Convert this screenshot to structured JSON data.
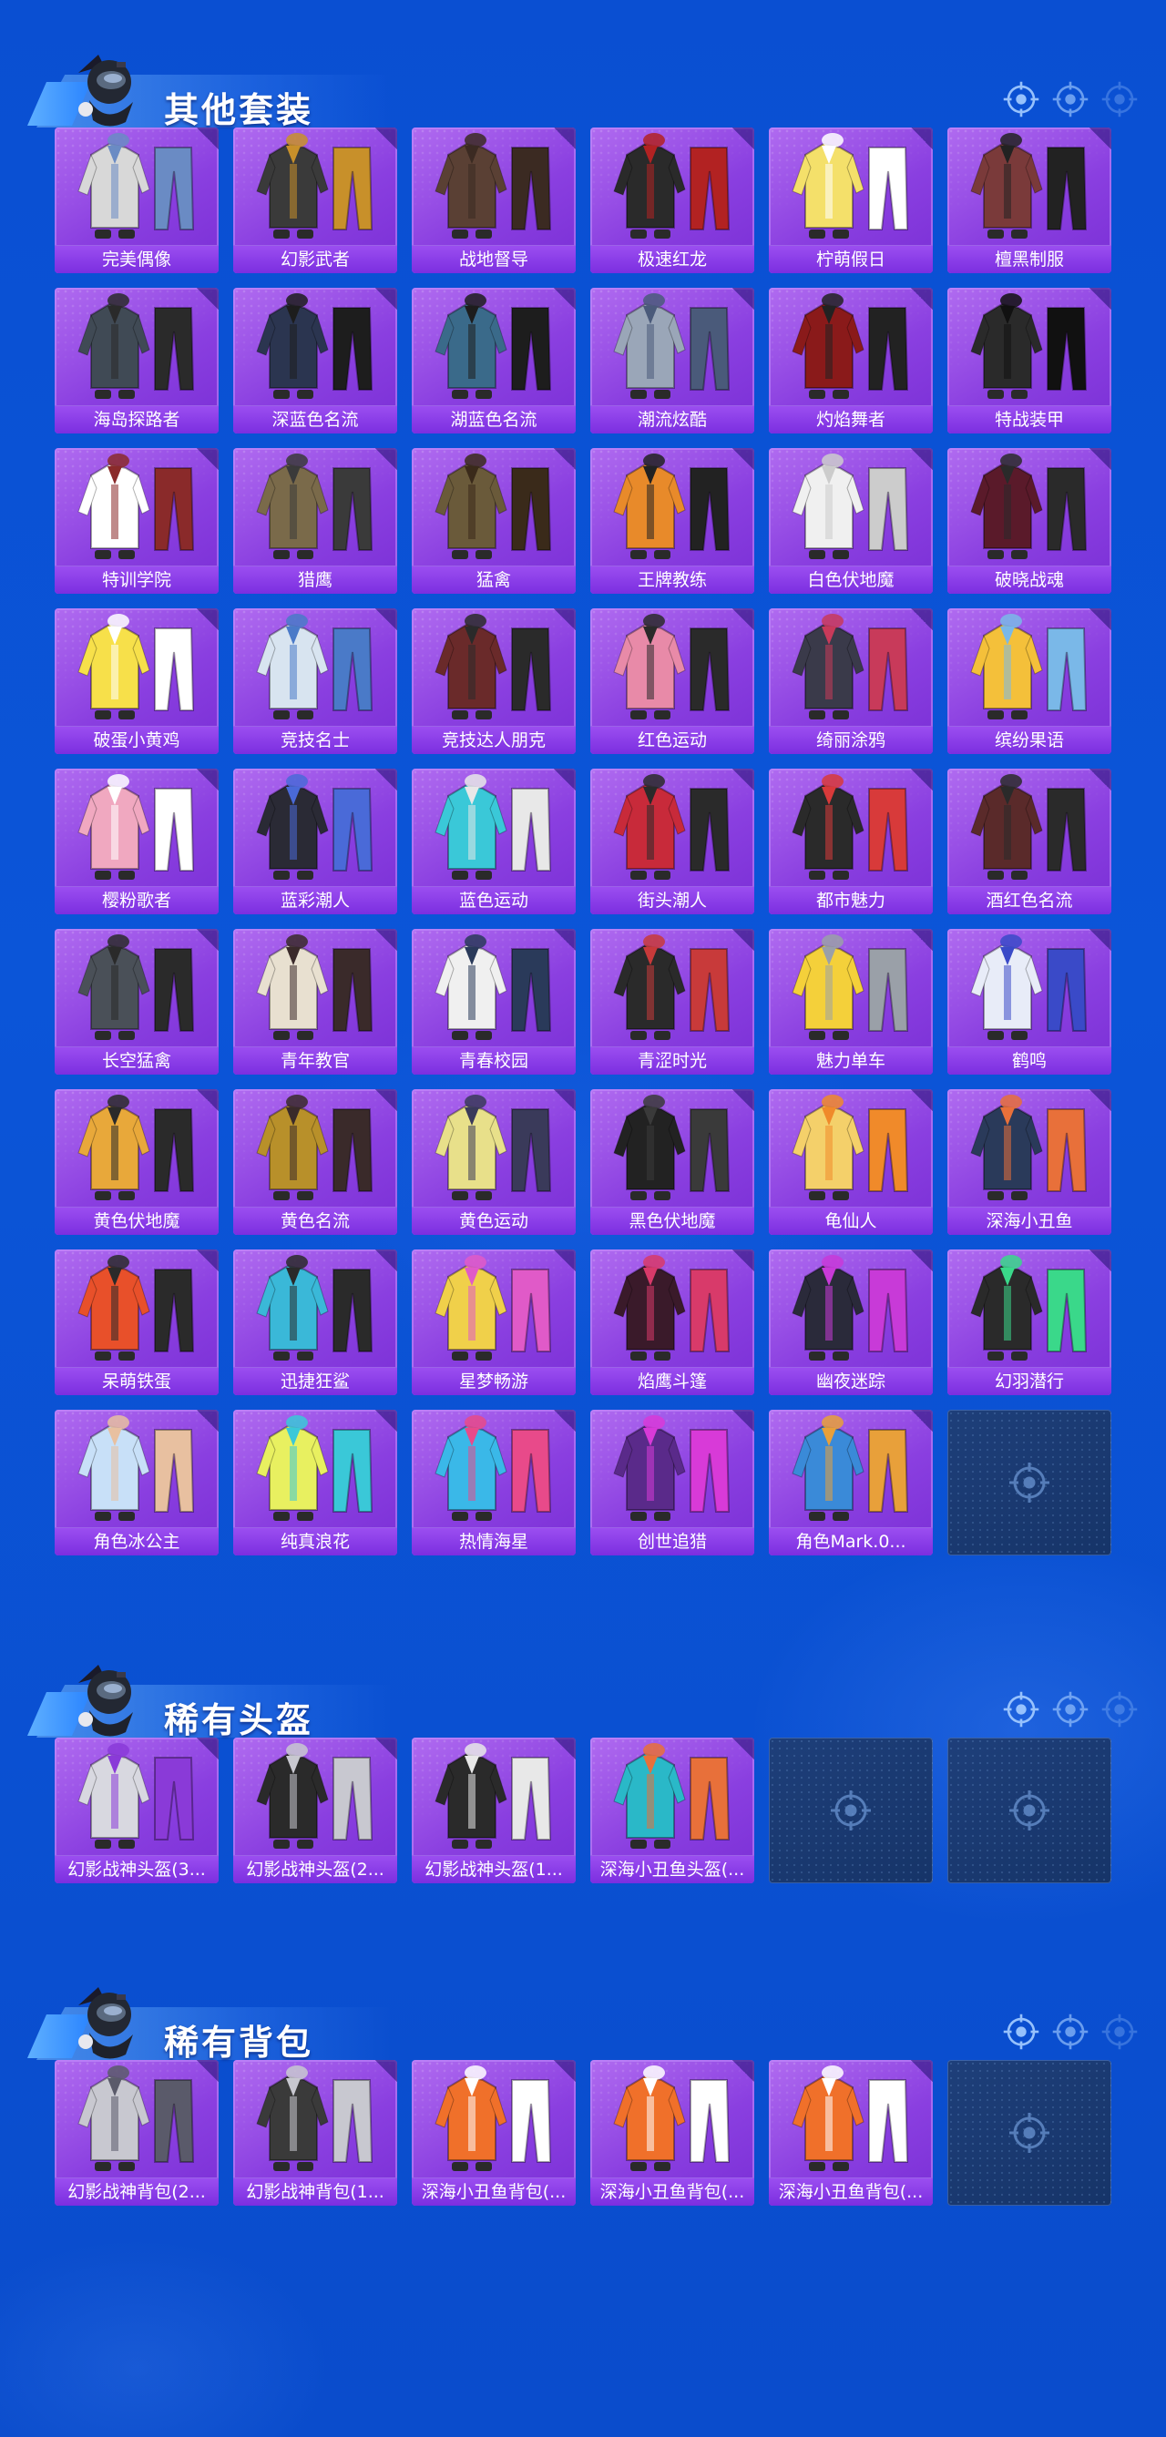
{
  "sections": [
    {
      "title": "其他套装",
      "items": [
        {
          "label": "完美偶像",
          "hue": "#d8d8d8",
          "acc": "#6a8bc4"
        },
        {
          "label": "幻影武者",
          "hue": "#3a3a3a",
          "acc": "#c8902a"
        },
        {
          "label": "战地督导",
          "hue": "#5a4034",
          "acc": "#3b2a22"
        },
        {
          "label": "极速红龙",
          "hue": "#2a2a2a",
          "acc": "#b22222"
        },
        {
          "label": "柠萌假日",
          "hue": "#f4e06a",
          "acc": "#ffffff"
        },
        {
          "label": "檀黑制服",
          "hue": "#7a3a3a",
          "acc": "#222222"
        },
        {
          "label": "海岛探路者",
          "hue": "#404a55",
          "acc": "#2a2a2a"
        },
        {
          "label": "深蓝色名流",
          "hue": "#2b3550",
          "acc": "#1d1d1d"
        },
        {
          "label": "湖蓝色名流",
          "hue": "#3a6a8a",
          "acc": "#1d1d1d"
        },
        {
          "label": "潮流炫酷",
          "hue": "#9aa6b8",
          "acc": "#4a5a7a"
        },
        {
          "label": "灼焰舞者",
          "hue": "#8a1a1a",
          "acc": "#222222"
        },
        {
          "label": "特战装甲",
          "hue": "#2a2a2a",
          "acc": "#111111"
        },
        {
          "label": "特训学院",
          "hue": "#ffffff",
          "acc": "#8a2a2a"
        },
        {
          "label": "猎鹰",
          "hue": "#7a6a4a",
          "acc": "#3a3a3a"
        },
        {
          "label": "猛禽",
          "hue": "#6a5a3a",
          "acc": "#3a2a1a"
        },
        {
          "label": "王牌教练",
          "hue": "#e88a2a",
          "acc": "#222222"
        },
        {
          "label": "白色伏地魔",
          "hue": "#f0f0f0",
          "acc": "#cccccc"
        },
        {
          "label": "破晓战魂",
          "hue": "#5a1a2a",
          "acc": "#2a2a2a"
        },
        {
          "label": "破蛋小黄鸡",
          "hue": "#f7e04a",
          "acc": "#ffffff"
        },
        {
          "label": "竞技名士",
          "hue": "#d8e4f0",
          "acc": "#4a7ac8"
        },
        {
          "label": "竞技达人朋克",
          "hue": "#6a2a2a",
          "acc": "#2a2a2a"
        },
        {
          "label": "红色运动",
          "hue": "#e88aa8",
          "acc": "#2a2a2a"
        },
        {
          "label": "绮丽涂鸦",
          "hue": "#3a3a4a",
          "acc": "#c83a5a"
        },
        {
          "label": "缤纷果语",
          "hue": "#f4c03a",
          "acc": "#7ab8e8"
        },
        {
          "label": "樱粉歌者",
          "hue": "#f0a8c0",
          "acc": "#ffffff"
        },
        {
          "label": "蓝彩潮人",
          "hue": "#2a2a35",
          "acc": "#4a6ad8"
        },
        {
          "label": "蓝色运动",
          "hue": "#3ac8d8",
          "acc": "#e8e8e8"
        },
        {
          "label": "街头潮人",
          "hue": "#c82a3a",
          "acc": "#2a2a2a"
        },
        {
          "label": "都市魅力",
          "hue": "#2a2a2a",
          "acc": "#d83a3a"
        },
        {
          "label": "酒红色名流",
          "hue": "#5a2a2a",
          "acc": "#2a2a2a"
        },
        {
          "label": "长空猛禽",
          "hue": "#4a5058",
          "acc": "#2a2a2a"
        },
        {
          "label": "青年教官",
          "hue": "#e8e0d0",
          "acc": "#3a2a2a"
        },
        {
          "label": "青春校园",
          "hue": "#f0f0f0",
          "acc": "#2a3a5a"
        },
        {
          "label": "青涩时光",
          "hue": "#2a2a2a",
          "acc": "#c83a3a"
        },
        {
          "label": "魅力单车",
          "hue": "#f4d03a",
          "acc": "#9aa0a8"
        },
        {
          "label": "鹤鸣",
          "hue": "#e8ecf8",
          "acc": "#3a4ac8"
        },
        {
          "label": "黄色伏地魔",
          "hue": "#e8a83a",
          "acc": "#2a2a2a"
        },
        {
          "label": "黄色名流",
          "hue": "#b8902a",
          "acc": "#3a2a2a"
        },
        {
          "label": "黄色运动",
          "hue": "#e8e08a",
          "acc": "#3a3a5a"
        },
        {
          "label": "黑色伏地魔",
          "hue": "#222222",
          "acc": "#3a3a3a"
        },
        {
          "label": "龟仙人",
          "hue": "#f4d06a",
          "acc": "#f08a2a"
        },
        {
          "label": "深海小丑鱼",
          "hue": "#2a3a5a",
          "acc": "#e8703a"
        },
        {
          "label": "呆萌铁蛋",
          "hue": "#e8502a",
          "acc": "#2a2a2a"
        },
        {
          "label": "迅捷狂鲨",
          "hue": "#3ab8d8",
          "acc": "#2a2a2a"
        },
        {
          "label": "星梦畅游",
          "hue": "#f0d04a",
          "acc": "#e05ac8"
        },
        {
          "label": "焰鹰斗篷",
          "hue": "#3a1a2a",
          "acc": "#d83a6a"
        },
        {
          "label": "幽夜迷踪",
          "hue": "#2a2a3a",
          "acc": "#c83ad8"
        },
        {
          "label": "幻羽潜行",
          "hue": "#2a2a2a",
          "acc": "#3ad88a"
        },
        {
          "label": "角色冰公主",
          "hue": "#c8e0f8",
          "acc": "#e8c0a0"
        },
        {
          "label": "纯真浪花",
          "hue": "#e8f060",
          "acc": "#3ac8d8"
        },
        {
          "label": "热情海星",
          "hue": "#3ab8e8",
          "acc": "#e84a8a"
        },
        {
          "label": "创世追猎",
          "hue": "#5a2a8a",
          "acc": "#d83ad8"
        },
        {
          "label": "角色Mark.0...",
          "hue": "#3a8ad8",
          "acc": "#e8a03a"
        }
      ],
      "empty_slots": 1
    },
    {
      "title": "稀有头盔",
      "items": [
        {
          "label": "幻影战神头盔(3...",
          "hue": "#d8d8e0",
          "acc": "#8a3ad8"
        },
        {
          "label": "幻影战神头盔(2...",
          "hue": "#2a2a2a",
          "acc": "#c8c8d0"
        },
        {
          "label": "幻影战神头盔(1...",
          "hue": "#2a2a2a",
          "acc": "#e8e8e8"
        },
        {
          "label": "深海小丑鱼头盔(...",
          "hue": "#2ab8c8",
          "acc": "#e8703a"
        }
      ],
      "empty_slots": 2
    },
    {
      "title": "稀有背包",
      "items": [
        {
          "label": "幻影战神背包(2...",
          "hue": "#c8c8d0",
          "acc": "#5a5a6a"
        },
        {
          "label": "幻影战神背包(1...",
          "hue": "#3a3a3a",
          "acc": "#c8c8d0"
        },
        {
          "label": "深海小丑鱼背包(...",
          "hue": "#f0702a",
          "acc": "#ffffff"
        },
        {
          "label": "深海小丑鱼背包(...",
          "hue": "#f0702a",
          "acc": "#ffffff"
        },
        {
          "label": "深海小丑鱼背包(...",
          "hue": "#f0702a",
          "acc": "#ffffff"
        }
      ],
      "empty_slots": 1
    }
  ],
  "colors": {
    "background": "#0b55d8",
    "card": "#8a3fe0",
    "label_bar": "#7b2ee0",
    "empty_slot": "#1a3a70"
  }
}
